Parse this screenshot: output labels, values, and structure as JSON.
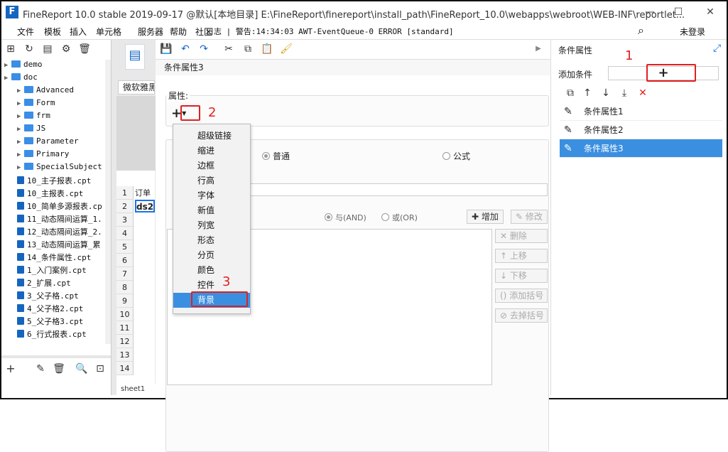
{
  "window": {
    "title": "FineReport 10.0 stable 2019-09-17 @默认[本地目录]    E:\\FineReport\\finereport\\install_path\\FineReport_10.0\\webapps\\webroot\\WEB-INF\\reportlet...",
    "minimize": "—",
    "maximize": "☐",
    "close": "✕"
  },
  "menubar": {
    "items": [
      "文件",
      "模板",
      "插入",
      "单元格",
      "服务器",
      "帮助",
      "社区"
    ],
    "status": "日志 | 警告:14:34:03 AWT-EventQueue-0 ERROR [standard]",
    "login": "未登录"
  },
  "tree": {
    "items": [
      {
        "label": "demo",
        "kind": "folder",
        "depth": 0
      },
      {
        "label": "doc",
        "kind": "folder",
        "depth": 0
      },
      {
        "label": "Advanced",
        "kind": "folder",
        "depth": 1
      },
      {
        "label": "Form",
        "kind": "folder",
        "depth": 1
      },
      {
        "label": "frm",
        "kind": "folder",
        "depth": 1
      },
      {
        "label": "JS",
        "kind": "folder",
        "depth": 1
      },
      {
        "label": "Parameter",
        "kind": "folder",
        "depth": 1
      },
      {
        "label": "Primary",
        "kind": "folder",
        "depth": 1
      },
      {
        "label": "SpecialSubject",
        "kind": "folder",
        "depth": 1
      },
      {
        "label": "10_主子报表.cpt",
        "kind": "file",
        "depth": 1
      },
      {
        "label": "10_主报表.cpt",
        "kind": "file",
        "depth": 1
      },
      {
        "label": "10_简单多源报表.cp",
        "kind": "file",
        "depth": 1
      },
      {
        "label": "11_动态隔间运算_1.",
        "kind": "file",
        "depth": 1
      },
      {
        "label": "12_动态隔间运算_2.",
        "kind": "file",
        "depth": 1
      },
      {
        "label": "13_动态隔间运算_累",
        "kind": "file",
        "depth": 1
      },
      {
        "label": "14_条件属性.cpt",
        "kind": "file",
        "depth": 1
      },
      {
        "label": "1_入门案例.cpt",
        "kind": "file",
        "depth": 1
      },
      {
        "label": "2_扩展.cpt",
        "kind": "file",
        "depth": 1
      },
      {
        "label": "3_父子格.cpt",
        "kind": "file",
        "depth": 1
      },
      {
        "label": "4_父子格2.cpt",
        "kind": "file",
        "depth": 1
      },
      {
        "label": "5_父子格3.cpt",
        "kind": "file",
        "depth": 1
      },
      {
        "label": "6_行式报表.cpt",
        "kind": "file",
        "depth": 1
      }
    ]
  },
  "sheet": {
    "font": "微软雅黑",
    "rows": [
      "1",
      "2",
      "3",
      "4",
      "5",
      "6",
      "7",
      "8",
      "9",
      "10",
      "11",
      "12",
      "13",
      "14"
    ],
    "cell_1": "订单",
    "cell_2": "ds2",
    "tab": "sheet1"
  },
  "dialog": {
    "title": "条件属性3",
    "attr_label": "属性:",
    "add_symbol": "+",
    "type_normal": "普通",
    "type_formula": "公式",
    "and": "与(AND)",
    "or": "或(OR)",
    "btn_add": "增加",
    "btn_edit": "修改",
    "btn_delete": "删除",
    "btn_up": "上移",
    "btn_down": "下移",
    "btn_add_bracket": "添加括号",
    "btn_remove_bracket": "去掉括号",
    "dropdown": [
      "超级链接",
      "缩进",
      "边框",
      "行高",
      "字体",
      "新值",
      "列宽",
      "形态",
      "分页",
      "颜色",
      "控件",
      "背景"
    ],
    "selected_dropdown_index": 11
  },
  "right": {
    "title": "条件属性",
    "add_label": "添加条件",
    "add_symbol": "+",
    "conditions": [
      "条件属性1",
      "条件属性2",
      "条件属性3"
    ],
    "selected_index": 2
  },
  "annotations": {
    "step1": "1",
    "step2": "2",
    "step3": "3"
  }
}
